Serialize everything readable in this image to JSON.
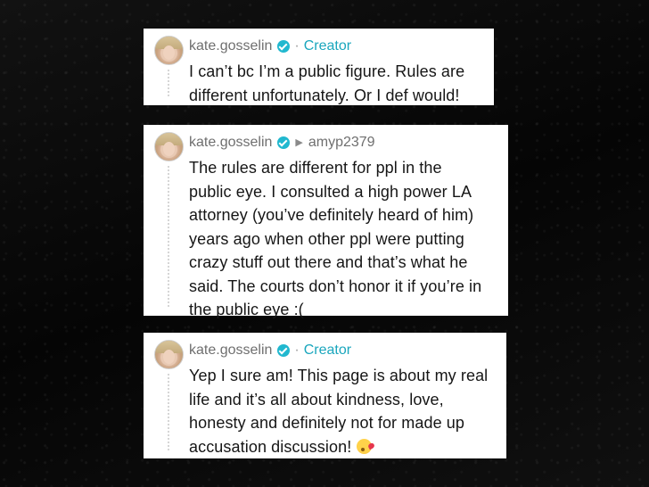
{
  "comments": [
    {
      "username": "kate.gosselin",
      "badge": "Creator",
      "reply_to": "",
      "lines": [
        "I can’t bc I’m a public figure. Rules are",
        "different unfortunately. Or I def would!"
      ]
    },
    {
      "username": "kate.gosselin",
      "badge": "",
      "reply_to": "amyp2379",
      "lines": [
        "The rules are different for ppl in the",
        "public eye. I consulted a high power LA",
        "attorney (you’ve definitely heard of him)",
        "years ago when other ppl were putting",
        "crazy stuff out there and that’s what he",
        "said. The courts don’t honor it if you’re in",
        "the public eye :("
      ]
    },
    {
      "username": "kate.gosselin",
      "badge": "Creator",
      "reply_to": "",
      "lines": [
        "Yep I sure am! This page is about my real",
        "life and it’s all about kindness, love,",
        "honesty and definitely not for made up",
        "accusation discussion!"
      ],
      "trailing_emoji": "face-blowing-kiss-emoji"
    }
  ],
  "icons": {
    "verified": "verified-badge-icon",
    "reply_arrow": "reply-arrow-icon"
  },
  "colors": {
    "accent": "#1aa6bd",
    "verified": "#21b8cf",
    "background": "#0b0b0b",
    "card": "#ffffff"
  }
}
